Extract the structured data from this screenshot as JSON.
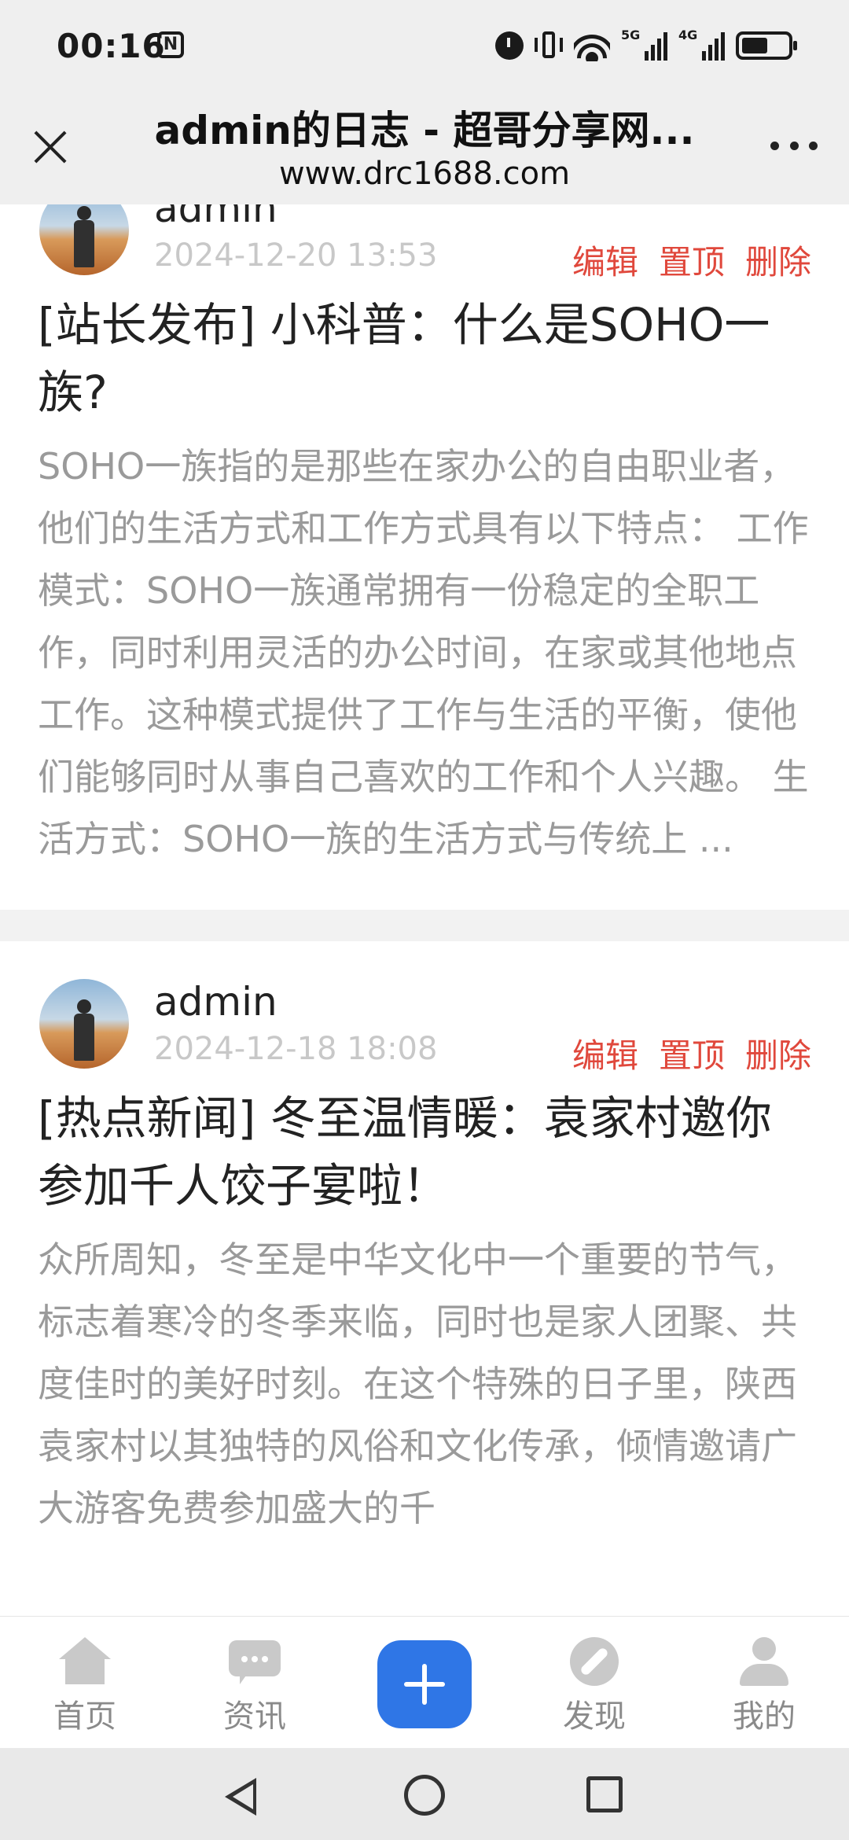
{
  "status_bar": {
    "time": "00:16",
    "nfc_label": "N",
    "signal1_tag": "5G",
    "signal2_tag": "4G",
    "icons": [
      "alarm-icon",
      "vibrate-icon",
      "wifi-icon",
      "signal-icon",
      "battery-icon"
    ],
    "battery_level": 0.58
  },
  "title_bar": {
    "title": "admin的日志 - 超哥分享网...",
    "url": "www.drc1688.com"
  },
  "posts": [
    {
      "username": "admin",
      "date": "2024-12-20 13:53",
      "actions": [
        "编辑",
        "置顶",
        "删除"
      ],
      "title": "[站长发布] 小科普：什么是SOHO一族?",
      "excerpt": "SOHO一族指的是那些在家办公的自由职业者，他们的生活方式和工作方式具有以下特点： 工作模式：SOHO一族通常拥有一份稳定的全职工作，同时利用灵活的办公时间，在家或其他地点工作。这种模式提供了工作与生活的平衡，使他们能够同时从事自己喜欢的工作和个人兴趣。 生活方式：SOHO一族的生活方式与传统上 ..."
    },
    {
      "username": "admin",
      "date": "2024-12-18 18:08",
      "actions": [
        "编辑",
        "置顶",
        "删除"
      ],
      "title": "[热点新闻] 冬至温情暖：袁家村邀你参加千人饺子宴啦！",
      "excerpt": "众所周知，冬至是中华文化中一个重要的节气，标志着寒冷的冬季来临，同时也是家人团聚、共度佳时的美好时刻。在这个特殊的日子里，陕西袁家村以其独特的风俗和文化传承，倾情邀请广大游客免费参加盛大的千"
    }
  ],
  "bottom_nav": {
    "items": [
      {
        "label": "首页",
        "icon": "home-icon"
      },
      {
        "label": "资讯",
        "icon": "chat-icon"
      },
      {
        "label": "发现",
        "icon": "compass-icon"
      },
      {
        "label": "我的",
        "icon": "user-icon"
      }
    ],
    "center_icon": "plus-icon",
    "accent": "#2f76e6"
  },
  "colors": {
    "action_red": "#e0483c",
    "date_gray": "#c8c8c8",
    "excerpt_gray": "#9a9a9a"
  }
}
